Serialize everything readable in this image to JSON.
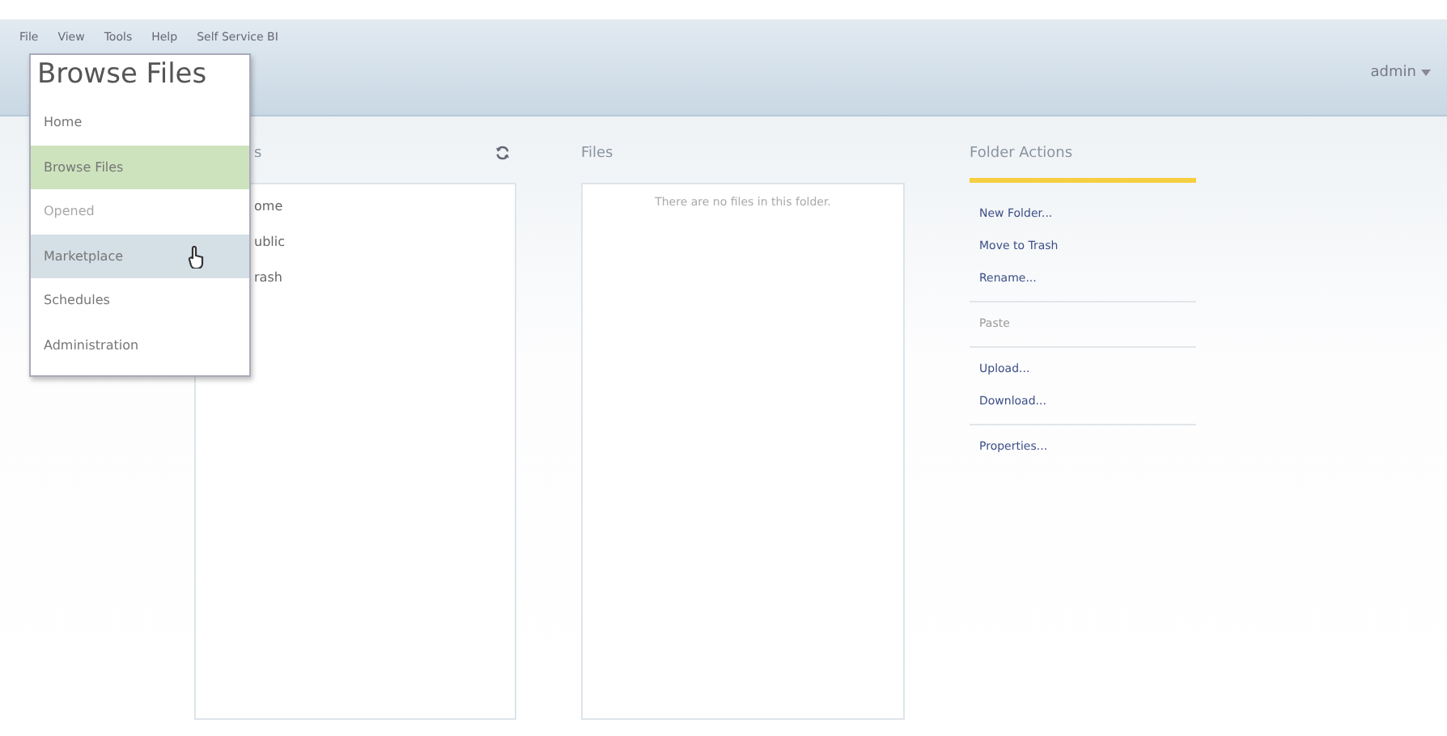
{
  "menu_bar": [
    {
      "label": "File"
    },
    {
      "label": "View"
    },
    {
      "label": "Tools"
    },
    {
      "label": "Help"
    },
    {
      "label": "Self Service BI"
    }
  ],
  "user_menu": {
    "label": "admin"
  },
  "perspective_menu": {
    "title": "Browse Files",
    "items": [
      {
        "label": "Home",
        "selected": false,
        "disabled": false,
        "hovered": false
      },
      {
        "label": "Browse Files",
        "selected": true,
        "disabled": false,
        "hovered": false
      },
      {
        "label": "Opened",
        "selected": false,
        "disabled": true,
        "hovered": false
      },
      {
        "label": "Marketplace",
        "selected": false,
        "disabled": false,
        "hovered": true
      },
      {
        "label": "Schedules",
        "selected": false,
        "disabled": false,
        "hovered": false
      },
      {
        "label": "Administration",
        "selected": false,
        "disabled": false,
        "hovered": false
      }
    ]
  },
  "folders_panel": {
    "title": "s",
    "items": [
      {
        "label": "ome"
      },
      {
        "label": "ublic"
      },
      {
        "label": "rash"
      }
    ]
  },
  "files_panel": {
    "title": "Files",
    "empty_message": "There are no files in this folder."
  },
  "folder_actions": {
    "title": "Folder Actions",
    "groups": [
      [
        {
          "label": "New Folder...",
          "disabled": false
        },
        {
          "label": "Move to Trash",
          "disabled": false
        },
        {
          "label": "Rename...",
          "disabled": false
        }
      ],
      [
        {
          "label": "Paste",
          "disabled": true
        }
      ],
      [
        {
          "label": "Upload...",
          "disabled": false
        },
        {
          "label": "Download...",
          "disabled": false
        }
      ],
      [
        {
          "label": "Properties...",
          "disabled": false
        }
      ]
    ]
  }
}
